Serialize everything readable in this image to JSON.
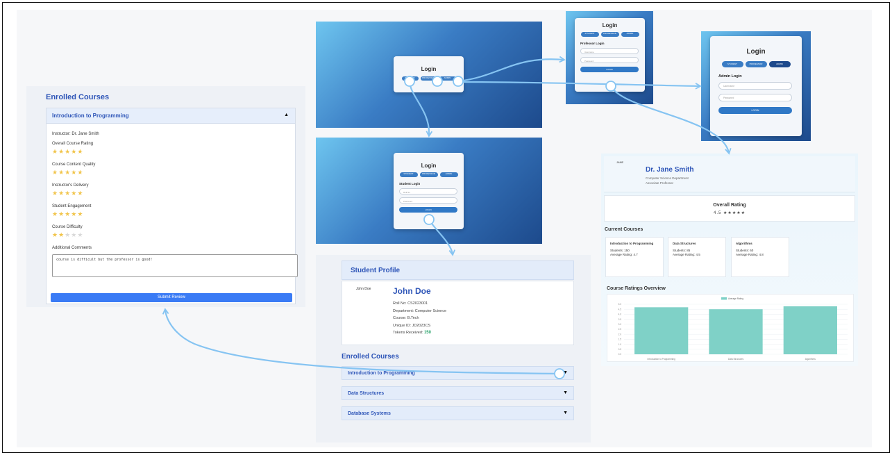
{
  "review_panel": {
    "title": "Enrolled Courses",
    "course": "Introduction to Programming",
    "caret": "▲",
    "instructor": "Instructor: Dr. Jane Smith",
    "criteria": [
      {
        "label": "Overall Course Rating",
        "rating": 5
      },
      {
        "label": "Course Content Quality",
        "rating": 5
      },
      {
        "label": "Instructor's Delivery",
        "rating": 5
      },
      {
        "label": "Student Engagement",
        "rating": 5
      },
      {
        "label": "Course Difficulty",
        "rating": 2
      }
    ],
    "comments_label": "Additional Comments",
    "comment_value": "course is difficult but the professor is good!",
    "submit_label": "Submit Review"
  },
  "login_main": {
    "title": "Login",
    "roles": [
      "STUDENT",
      "PROFESSOR",
      "ADMIN"
    ]
  },
  "login_student": {
    "title": "Login",
    "roles": [
      "STUDENT",
      "PROFESSOR",
      "ADMIN"
    ],
    "subtitle": "Student Login",
    "field1": "Roll No",
    "field2": "Password",
    "button": "LOGIN"
  },
  "login_professor": {
    "title": "Login",
    "roles": [
      "STUDENT",
      "PROFESSOR",
      "ADMIN"
    ],
    "subtitle": "Professor Login",
    "field1": "Username",
    "field2": "Password",
    "button": "LOGIN"
  },
  "login_admin": {
    "title": "Login",
    "roles": [
      "STUDENT",
      "PROFESSOR",
      "ADMIN"
    ],
    "subtitle": "Admin Login",
    "field1": "Username",
    "field2": "Password",
    "button": "LOGIN"
  },
  "student_profile": {
    "header": "Student Profile",
    "photo_label": "John Doe",
    "name": "John Doe",
    "roll": "Roll No: CS2023001",
    "department": "Department: Computer Science",
    "course": "Course: B.Tech",
    "unique_id": "Unique ID: JD2023CS",
    "tokens_label": "Tokens Received:",
    "tokens_value": "150",
    "enrolled_title": "Enrolled Courses",
    "courses": [
      "Introduction to Programming",
      "Data Structures",
      "Database Systems"
    ],
    "caret": "▼"
  },
  "professor": {
    "photo_label": "JANE",
    "name": "Dr. Jane Smith",
    "department": "Computer Science Department",
    "position": "Associate Professor",
    "overall_title": "Overall Rating",
    "overall_value": "4.5 ★★★★★",
    "current_title": "Current Courses",
    "courses": [
      {
        "name": "Introduction to Programming",
        "students": "Students: 150",
        "rating": "Average Rating: 4.7"
      },
      {
        "name": "Data Structures",
        "students": "Students: 85",
        "rating": "Average Rating: 4.5"
      },
      {
        "name": "Algorithms",
        "students": "Students: 60",
        "rating": "Average Rating: 4.8"
      }
    ],
    "overview_title": "Course Ratings Overview"
  },
  "chart_data": {
    "type": "bar",
    "categories": [
      "Introduction to Programming",
      "Data Structures",
      "Algorithms"
    ],
    "series": [
      {
        "name": "Average Rating",
        "values": [
          4.7,
          4.5,
          4.8
        ]
      }
    ],
    "ylim": [
      0,
      5
    ],
    "color": "#7fd1c7",
    "legend": "top-center"
  },
  "colors": {
    "accent": "#2f56b8",
    "button": "#3a7bf5",
    "arrow": "#86c4f2",
    "star_on": "#f1c44a"
  }
}
